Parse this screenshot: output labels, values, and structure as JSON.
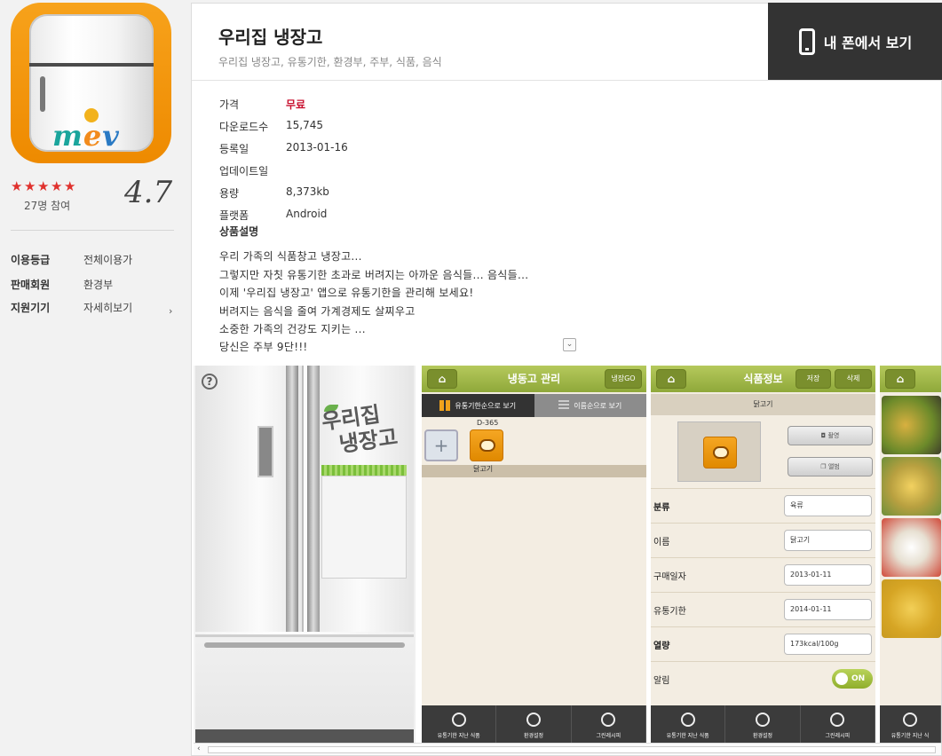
{
  "app": {
    "title": "우리집 냉장고",
    "tags": "우리집 냉장고, 유통기한, 환경부, 주부, 식품, 음식",
    "icon_brand": {
      "m": "m",
      "e": "e",
      "v": "v"
    },
    "view_on_phone": "내 폰에서 보기"
  },
  "rating": {
    "value": "4.7",
    "stars": 4.7,
    "participants": "27명 참여",
    "star_color": "#e0312d"
  },
  "meta": [
    {
      "key": "이용등급",
      "value": "전체이용가"
    },
    {
      "key": "판매회원",
      "value": "환경부"
    },
    {
      "key": "지원기기",
      "value": "자세히보기"
    }
  ],
  "info": [
    {
      "key": "가격",
      "value": "무료"
    },
    {
      "key": "다운로드수",
      "value": "15,745"
    },
    {
      "key": "등록일",
      "value": "2013-01-16"
    },
    {
      "key": "업데이트일",
      "value": ""
    },
    {
      "key": "용량",
      "value": "8,373kb"
    },
    {
      "key": "플랫폼",
      "value": "Android"
    }
  ],
  "description": {
    "heading": "상품설명",
    "lines": [
      "우리 가족의 식품창고 냉장고...",
      "그렇지만 자칫 유통기한 초과로 버려지는 아까운 음식들... 음식들...",
      "이제 '우리집 냉장고' 앱으로 유통기한을 관리해 보세요!",
      "버려지는 음식을 줄여 가계경제도 살찌우고",
      "소중한 가족의 건강도 지키는 ...",
      "당신은 주부 9단!!!"
    ]
  },
  "screens": {
    "s1": {
      "help": "?",
      "logo_line1": "우리집",
      "logo_line2": "냉장고"
    },
    "s2": {
      "title": "냉동고 관리",
      "go_btn": "냉장GO",
      "tab_on": "유통기한순으로 보기",
      "tab_off": "이름순으로 보기",
      "dday": "D-365",
      "food_label": "닭고기",
      "bottom": [
        "유통기한 지난 식품",
        "환경설정",
        "그린레시피"
      ]
    },
    "s3": {
      "title": "식품정보",
      "save_btn": "저장",
      "delete_btn": "삭제",
      "subtitle": "닭고기",
      "camera_btn": "촬영",
      "album_btn": "앨범",
      "rows": [
        {
          "label": "분류",
          "value": "육류"
        },
        {
          "label": "이름",
          "value": "닭고기"
        },
        {
          "label": "구매일자",
          "value": "2013-01-11"
        },
        {
          "label": "유통기한",
          "value": "2014-01-11"
        },
        {
          "label": "열량",
          "value": "173kcal/100g"
        },
        {
          "label": "알림",
          "value": "ON"
        }
      ],
      "bottom": [
        "유통기한 지난 식품",
        "환경설정",
        "그린레시피"
      ]
    },
    "s4": {
      "bottom": [
        "유통기한 지난 식"
      ]
    }
  }
}
